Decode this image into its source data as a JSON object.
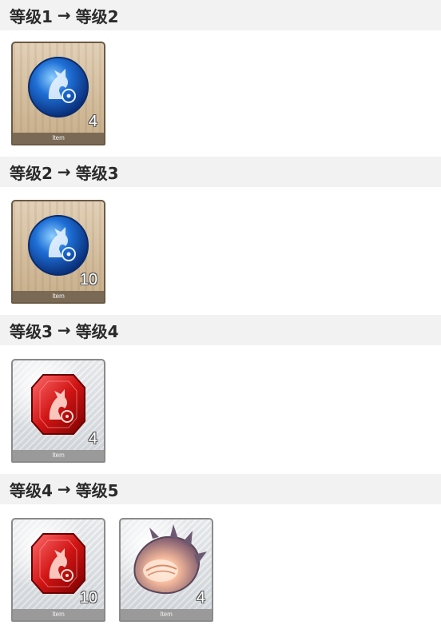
{
  "sections": [
    {
      "from": "等级1",
      "arrow": "→",
      "to": "等级2",
      "items": [
        {
          "kind": "blue-emblem-coin",
          "frame": "wood",
          "count": "4",
          "footer": "Item"
        }
      ]
    },
    {
      "from": "等级2",
      "arrow": "→",
      "to": "等级3",
      "items": [
        {
          "kind": "blue-emblem-coin",
          "frame": "wood",
          "count": "10",
          "footer": "Item"
        }
      ]
    },
    {
      "from": "等级3",
      "arrow": "→",
      "to": "等级4",
      "items": [
        {
          "kind": "red-emblem-gem",
          "frame": "silver",
          "count": "4",
          "footer": "Item"
        }
      ]
    },
    {
      "from": "等级4",
      "arrow": "→",
      "to": "等级5",
      "items": [
        {
          "kind": "red-emblem-gem",
          "frame": "silver",
          "count": "10",
          "footer": "Item"
        },
        {
          "kind": "spiral-seashell",
          "frame": "silver",
          "count": "4",
          "footer": "Item"
        }
      ]
    }
  ]
}
